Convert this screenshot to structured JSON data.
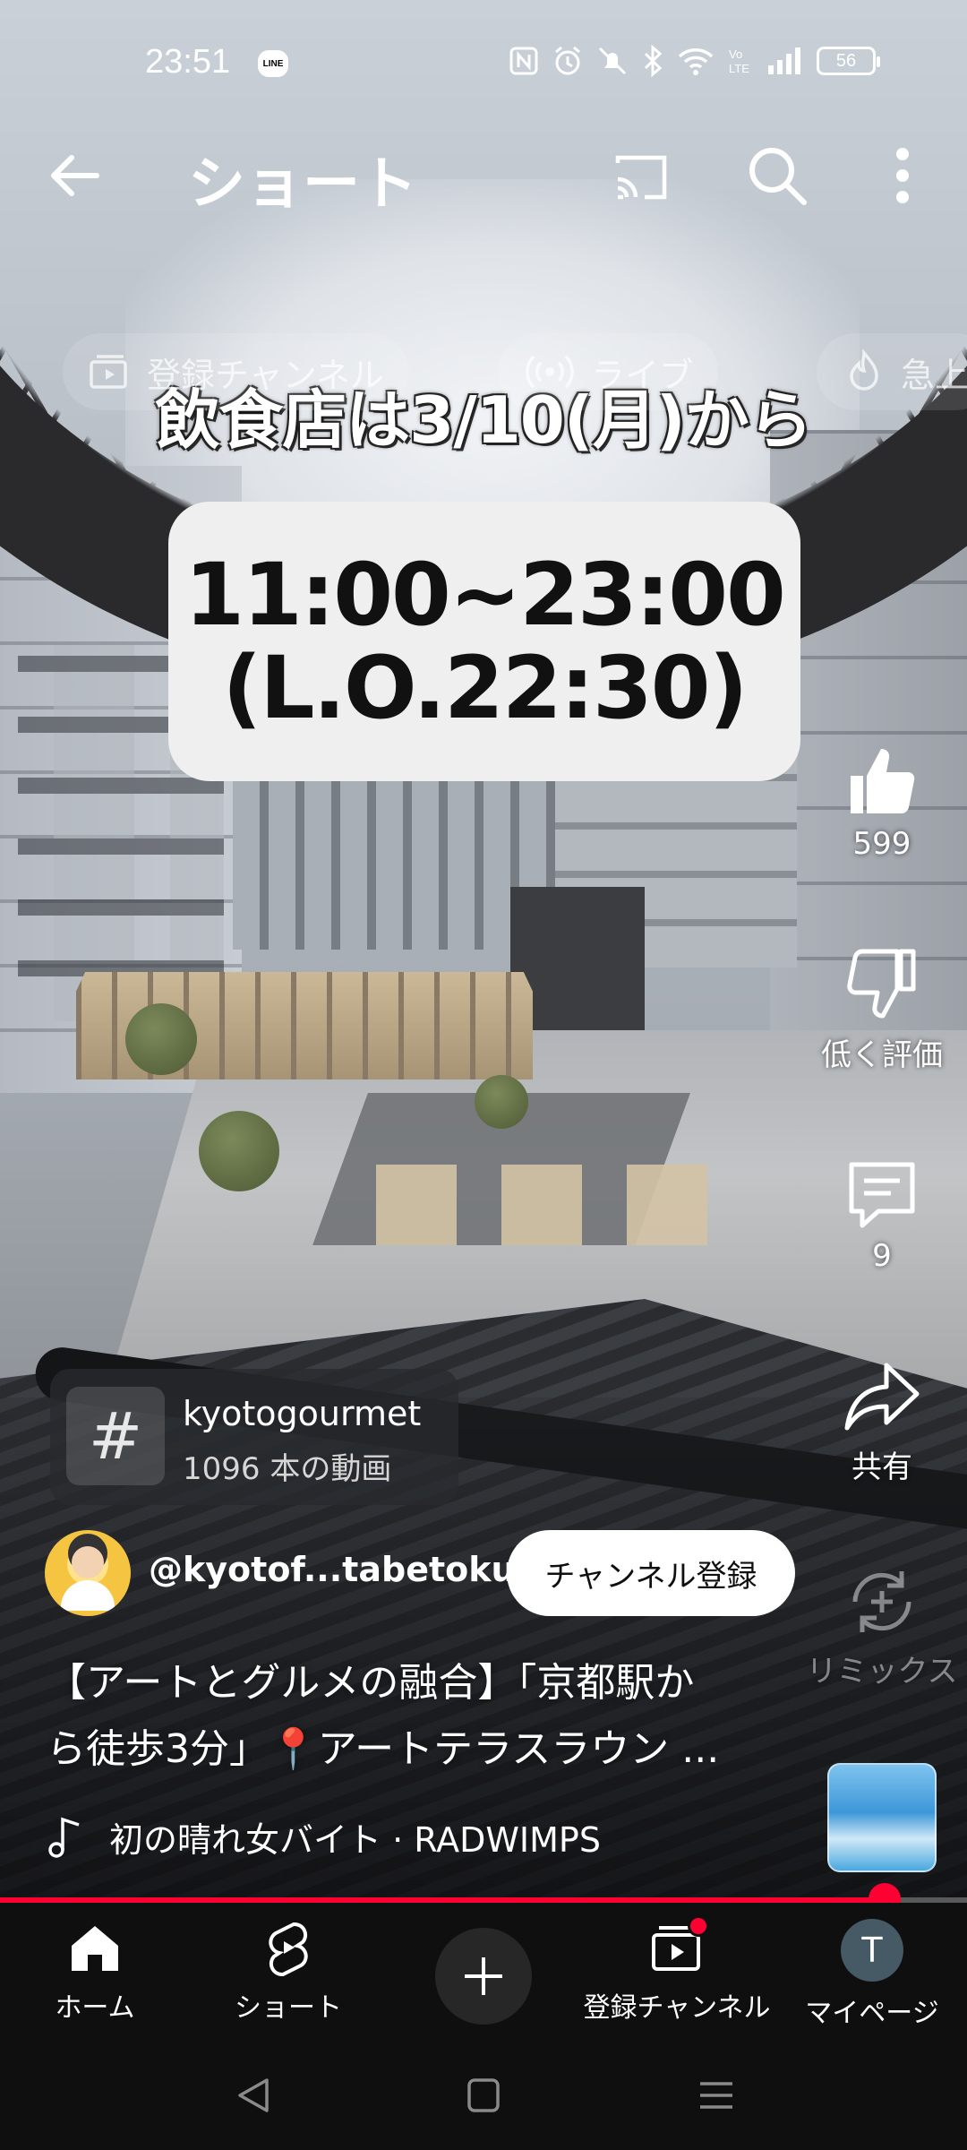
{
  "status_bar": {
    "time": "23:51",
    "line_badge": "LINE",
    "battery": "56"
  },
  "top_bar": {
    "title": "ショート"
  },
  "chips": [
    {
      "label": "登録チャンネル",
      "icon": "subscriptions-icon"
    },
    {
      "label": "ライブ",
      "icon": "live-icon"
    },
    {
      "label": "急上",
      "icon": "trending-icon"
    }
  ],
  "video": {
    "caption": "飲食店は3/10(月)から",
    "hours_line1": "11:00~23:00",
    "hours_line2": "(L.O.22:30)"
  },
  "actions": {
    "like_count": "599",
    "dislike_label": "低く評価",
    "comment_count": "9",
    "share_label": "共有",
    "remix_label": "リミックス"
  },
  "hashtag": {
    "symbol": "#",
    "name": "kyotogourmet",
    "count": "1096 本の動画"
  },
  "channel": {
    "handle": "@kyotof...tabetoku",
    "subscribe_label": "チャンネル登録"
  },
  "description": {
    "line1": "【アートとグルメの融合】「京都駅か",
    "line2": "ら徒歩3分」📍アートテラスラウン ..."
  },
  "music": {
    "track": "初の晴れ女バイト · RADWIMPS"
  },
  "progress": {
    "fraction": 0.915
  },
  "bottom_nav": {
    "home": "ホーム",
    "shorts": "ショート",
    "subscriptions": "登録チャンネル",
    "mypage": "マイページ",
    "avatar_initial": "T"
  },
  "colors": {
    "accent": "#ff0033",
    "nav_bg": "#0f0f0f"
  }
}
